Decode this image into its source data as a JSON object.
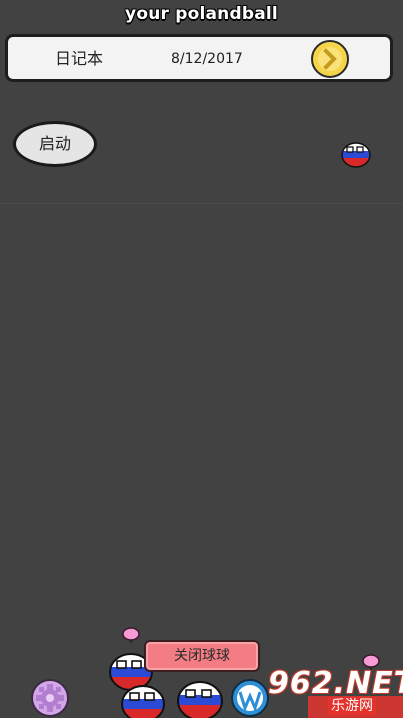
{
  "app": {
    "title": "your polandball"
  },
  "diary": {
    "label": "日记本",
    "date": "8/12/2017",
    "next_icon": "chevron-right-icon"
  },
  "start_button": {
    "label": "启动"
  },
  "close_button": {
    "label": "关闭球球"
  },
  "icons": {
    "settings": "gear-icon",
    "wordpress": "wordpress-icon"
  },
  "watermark": {
    "main": "962.NET",
    "sub": "乐游网"
  },
  "colors": {
    "background": "#424242",
    "diary_bar": "#f3f3f3",
    "next_button": "#f6d44a",
    "close_button": "#f47d85",
    "settings_button": "#d3a6e8",
    "ball_white": "#ffffff",
    "ball_blue": "#2b4bd6",
    "ball_red": "#d9282a",
    "watermark_red": "#e5322d"
  }
}
